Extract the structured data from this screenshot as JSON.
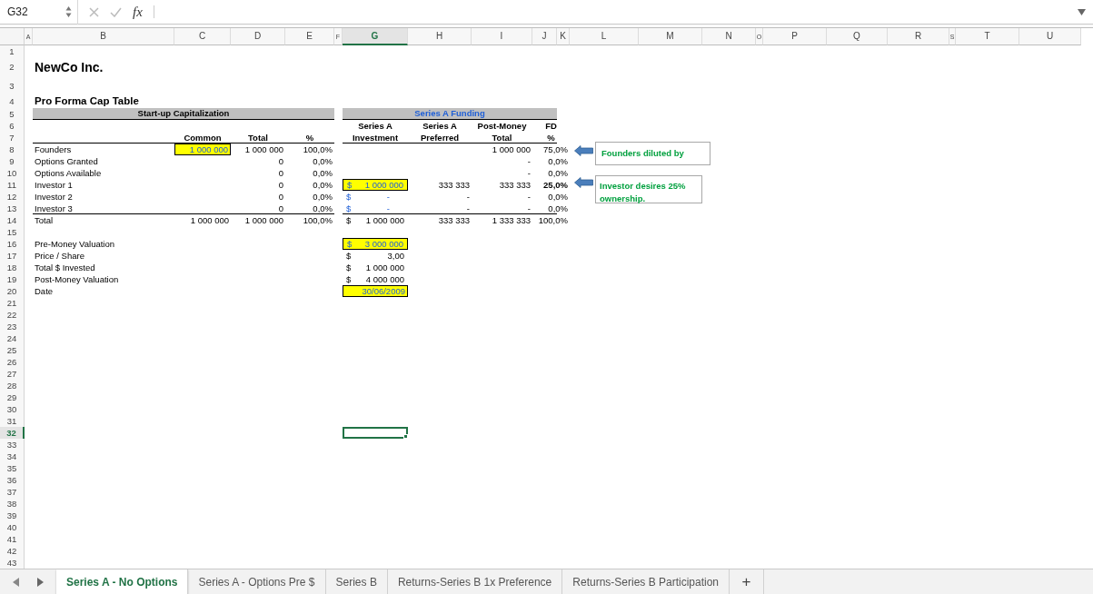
{
  "formula_bar": {
    "name_box": "G32",
    "function_label": "fx"
  },
  "columns": [
    {
      "label": "A",
      "selected": false
    },
    {
      "label": "B",
      "selected": false
    },
    {
      "label": "C",
      "selected": false
    },
    {
      "label": "D",
      "selected": false
    },
    {
      "label": "E",
      "selected": false
    },
    {
      "label": "F",
      "selected": false
    },
    {
      "label": "G",
      "selected": true
    },
    {
      "label": "H",
      "selected": false
    },
    {
      "label": "I",
      "selected": false
    },
    {
      "label": "J",
      "selected": false
    },
    {
      "label": "K",
      "selected": false
    },
    {
      "label": "L",
      "selected": false
    },
    {
      "label": "M",
      "selected": false
    },
    {
      "label": "N",
      "selected": false
    },
    {
      "label": "O",
      "selected": false
    },
    {
      "label": "P",
      "selected": false
    },
    {
      "label": "Q",
      "selected": false
    },
    {
      "label": "R",
      "selected": false
    },
    {
      "label": "S",
      "selected": false
    },
    {
      "label": "T",
      "selected": false
    },
    {
      "label": "U",
      "selected": false
    }
  ],
  "rows": [
    {
      "label": "1",
      "selected": false,
      "rule_below": false
    },
    {
      "label": "2",
      "selected": false,
      "rule_below": false,
      "cells": [
        null,
        {
          "text": "NewCo Inc.",
          "kind": "title"
        }
      ]
    },
    {
      "label": "3",
      "selected": false,
      "rule_below": false
    },
    {
      "label": "4",
      "selected": false,
      "rule_below": false,
      "cells": [
        null,
        {
          "text": "Pro Forma Cap Table",
          "kind": "subtitle"
        }
      ]
    },
    {
      "label": "5",
      "selected": false,
      "rule_below": false,
      "cells": [
        null,
        {
          "text": "Start-up Capitalization",
          "kind": "band"
        },
        null,
        null,
        null,
        null,
        {
          "text": "Series A Funding",
          "kind": "band_blue"
        }
      ]
    },
    {
      "label": "6",
      "selected": false,
      "rule_below": false,
      "cells": [
        null,
        null,
        null,
        null,
        null,
        null,
        {
          "text": "Series A",
          "kind": "header"
        },
        {
          "text": "Series A",
          "kind": "header"
        },
        {
          "text": "Post-Money",
          "kind": "header"
        },
        {
          "text": "FD",
          "kind": "header"
        }
      ]
    },
    {
      "label": "7",
      "selected": false,
      "rule_below": true,
      "cells": [
        null,
        null,
        {
          "text": "Common",
          "kind": "header"
        },
        {
          "text": "Total",
          "kind": "header"
        },
        {
          "text": "%",
          "kind": "header"
        },
        null,
        {
          "text": "Investment",
          "kind": "header"
        },
        {
          "text": "Preferred",
          "kind": "header"
        },
        {
          "text": "Total",
          "kind": "header"
        },
        {
          "text": "%",
          "kind": "header"
        }
      ]
    },
    {
      "label": "8",
      "selected": false,
      "rule_below": false,
      "cells": [
        null,
        {
          "text": "Founders",
          "kind": "label"
        },
        {
          "text": "1 000 000",
          "kind": "input"
        },
        {
          "text": "1 000 000",
          "kind": "number"
        },
        {
          "text": "100,0%",
          "kind": "number"
        },
        null,
        null,
        null,
        {
          "text": "1 000 000",
          "kind": "number"
        },
        {
          "text": "75,0%",
          "kind": "number"
        }
      ]
    },
    {
      "label": "9",
      "selected": false,
      "rule_below": false,
      "cells": [
        null,
        {
          "text": "Options Granted",
          "kind": "label"
        },
        null,
        {
          "text": "0",
          "kind": "number"
        },
        {
          "text": "0,0%",
          "kind": "number"
        },
        null,
        null,
        null,
        {
          "text": "-",
          "kind": "number"
        },
        {
          "text": "0,0%",
          "kind": "number"
        }
      ]
    },
    {
      "label": "10",
      "selected": false,
      "rule_below": false,
      "cells": [
        null,
        {
          "text": "Options Available",
          "kind": "label"
        },
        null,
        {
          "text": "0",
          "kind": "number"
        },
        {
          "text": "0,0%",
          "kind": "number"
        },
        null,
        null,
        null,
        {
          "text": "-",
          "kind": "number"
        },
        {
          "text": "0,0%",
          "kind": "number"
        }
      ]
    },
    {
      "label": "11",
      "selected": false,
      "rule_below": false,
      "cells": [
        null,
        {
          "text": "Investor 1",
          "kind": "label"
        },
        null,
        {
          "text": "0",
          "kind": "number"
        },
        {
          "text": "0,0%",
          "kind": "number"
        },
        null,
        {
          "prefix": "$",
          "text": "1 000 000",
          "kind": "currency_input"
        },
        {
          "text": "333 333",
          "kind": "number"
        },
        {
          "text": "333 333",
          "kind": "number"
        },
        {
          "text": "25,0%",
          "kind": "number_bold"
        }
      ]
    },
    {
      "label": "12",
      "selected": false,
      "rule_below": false,
      "cells": [
        null,
        {
          "text": "Investor 2",
          "kind": "label"
        },
        null,
        {
          "text": "0",
          "kind": "number"
        },
        {
          "text": "0,0%",
          "kind": "number"
        },
        null,
        {
          "prefix": "$",
          "text": "-",
          "kind": "currency_blue"
        },
        {
          "text": "-",
          "kind": "number"
        },
        {
          "text": "-",
          "kind": "number"
        },
        {
          "text": "0,0%",
          "kind": "number"
        }
      ]
    },
    {
      "label": "13",
      "selected": false,
      "rule_below": true,
      "cells": [
        null,
        {
          "text": "Investor 3",
          "kind": "label"
        },
        null,
        {
          "text": "0",
          "kind": "number"
        },
        {
          "text": "0,0%",
          "kind": "number"
        },
        null,
        {
          "prefix": "$",
          "text": "-",
          "kind": "currency_blue"
        },
        {
          "text": "-",
          "kind": "number"
        },
        {
          "text": "-",
          "kind": "number"
        },
        {
          "text": "0,0%",
          "kind": "number"
        }
      ]
    },
    {
      "label": "14",
      "selected": false,
      "rule_below": false,
      "cells": [
        null,
        {
          "text": "Total",
          "kind": "label"
        },
        {
          "text": "1 000 000",
          "kind": "number"
        },
        {
          "text": "1 000 000",
          "kind": "number"
        },
        {
          "text": "100,0%",
          "kind": "number"
        },
        null,
        {
          "prefix": "$",
          "text": "1 000 000",
          "kind": "currency"
        },
        {
          "text": "333 333",
          "kind": "number"
        },
        {
          "text": "1 333 333",
          "kind": "number"
        },
        {
          "text": "100,0%",
          "kind": "number"
        }
      ]
    },
    {
      "label": "15",
      "selected": false,
      "rule_below": false
    },
    {
      "label": "16",
      "selected": false,
      "rule_below": false,
      "cells": [
        null,
        {
          "text": "Pre-Money Valuation",
          "kind": "label"
        },
        null,
        null,
        null,
        null,
        {
          "prefix": "$",
          "text": "3 000 000",
          "kind": "currency_input"
        }
      ]
    },
    {
      "label": "17",
      "selected": false,
      "rule_below": false,
      "cells": [
        null,
        {
          "text": "Price / Share",
          "kind": "label"
        },
        null,
        null,
        null,
        null,
        {
          "prefix": "$",
          "text": "3,00",
          "kind": "currency"
        }
      ]
    },
    {
      "label": "18",
      "selected": false,
      "rule_below": false,
      "cells": [
        null,
        {
          "text": "Total $ Invested",
          "kind": "label"
        },
        null,
        null,
        null,
        null,
        {
          "prefix": "$",
          "text": "1 000 000",
          "kind": "currency"
        }
      ]
    },
    {
      "label": "19",
      "selected": false,
      "rule_below": false,
      "cells": [
        null,
        {
          "text": "Post-Money Valuation",
          "kind": "label"
        },
        null,
        null,
        null,
        null,
        {
          "prefix": "$",
          "text": "4 000 000",
          "kind": "currency"
        }
      ]
    },
    {
      "label": "20",
      "selected": false,
      "rule_below": false,
      "cells": [
        null,
        {
          "text": "Date",
          "kind": "label"
        },
        null,
        null,
        null,
        null,
        {
          "text": "30/06/2009",
          "kind": "input"
        }
      ]
    },
    {
      "label": "21",
      "selected": false,
      "rule_below": false
    },
    {
      "label": "22",
      "selected": false,
      "rule_below": false
    },
    {
      "label": "23",
      "selected": false,
      "rule_below": false
    },
    {
      "label": "24",
      "selected": false,
      "rule_below": false
    },
    {
      "label": "25",
      "selected": false,
      "rule_below": false
    },
    {
      "label": "26",
      "selected": false,
      "rule_below": false
    },
    {
      "label": "27",
      "selected": false,
      "rule_below": false
    },
    {
      "label": "28",
      "selected": false,
      "rule_below": false
    },
    {
      "label": "29",
      "selected": false,
      "rule_below": false
    },
    {
      "label": "30",
      "selected": false,
      "rule_below": false
    },
    {
      "label": "31",
      "selected": false,
      "rule_below": false
    },
    {
      "label": "32",
      "selected": true,
      "rule_below": false
    },
    {
      "label": "33",
      "selected": false,
      "rule_below": false
    },
    {
      "label": "34",
      "selected": false,
      "rule_below": false
    },
    {
      "label": "35",
      "selected": false,
      "rule_below": false
    },
    {
      "label": "36",
      "selected": false,
      "rule_below": false
    },
    {
      "label": "37",
      "selected": false,
      "rule_below": false
    },
    {
      "label": "38",
      "selected": false,
      "rule_below": false
    },
    {
      "label": "39",
      "selected": false,
      "rule_below": false
    },
    {
      "label": "40",
      "selected": false,
      "rule_below": false
    },
    {
      "label": "41",
      "selected": false,
      "rule_below": false
    },
    {
      "label": "42",
      "selected": false,
      "rule_below": false
    },
    {
      "label": "43",
      "selected": false,
      "rule_below": false
    }
  ],
  "callouts": [
    {
      "text": "Founders diluted by"
    },
    {
      "text": "Investor desires 25% ownership."
    }
  ],
  "sheet_tabs": [
    {
      "label": "Series A - No Options",
      "selected": true
    },
    {
      "label": "Series A - Options Pre $",
      "selected": false
    },
    {
      "label": "Series B",
      "selected": false
    },
    {
      "label": "Returns-Series B 1x Preference",
      "selected": false
    },
    {
      "label": "Returns-Series B Participation",
      "selected": false
    }
  ],
  "add_sheet": "+"
}
